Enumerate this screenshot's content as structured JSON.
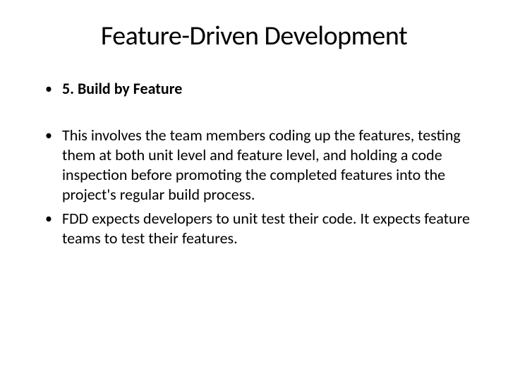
{
  "slide": {
    "title": "Feature-Driven Development",
    "bullets": [
      {
        "text": "5. Build by Feature",
        "bold": true
      },
      {
        "text": "This involves the team members coding up the features, testing them at both unit level and feature level, and holding a code inspection before promoting the completed features into the project's regular build process.",
        "bold": false
      },
      {
        "text": "FDD expects developers to unit test their code. It expects feature teams to test their features.",
        "bold": false
      }
    ]
  }
}
